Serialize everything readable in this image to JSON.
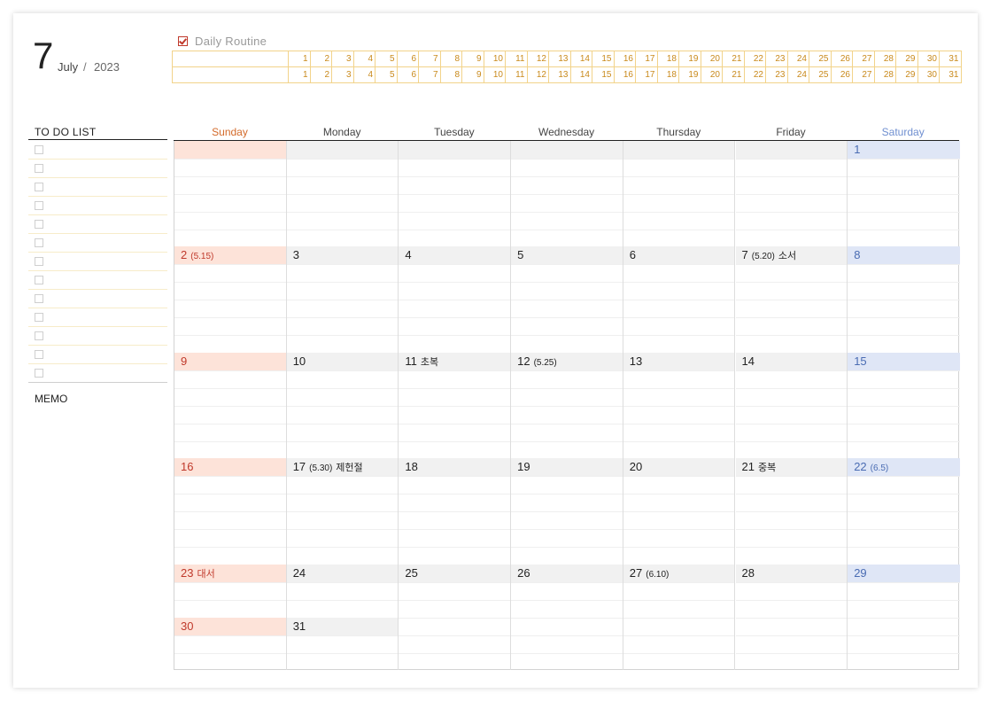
{
  "header": {
    "month_number": "7",
    "month_name": "July",
    "separator": "/",
    "year": "2023"
  },
  "routine": {
    "title": "Daily Routine",
    "checkbox_color": "#c0392b",
    "days": [
      "1",
      "2",
      "3",
      "4",
      "5",
      "6",
      "7",
      "8",
      "9",
      "10",
      "11",
      "12",
      "13",
      "14",
      "15",
      "16",
      "17",
      "18",
      "19",
      "20",
      "21",
      "22",
      "23",
      "24",
      "25",
      "26",
      "27",
      "28",
      "29",
      "30",
      "31"
    ],
    "rows": 2
  },
  "todo": {
    "title": "TO DO LIST",
    "item_count": 13
  },
  "memo": {
    "title": "MEMO"
  },
  "calendar": {
    "weekdays": [
      "Sunday",
      "Monday",
      "Tuesday",
      "Wednesday",
      "Thursday",
      "Friday",
      "Saturday"
    ],
    "weekday_colors": {
      "sunday": "#d36a2a",
      "saturday": "#6f8fd0",
      "default": "#444444"
    },
    "weeks": [
      [
        {
          "d": ""
        },
        {
          "d": ""
        },
        {
          "d": ""
        },
        {
          "d": ""
        },
        {
          "d": ""
        },
        {
          "d": ""
        },
        {
          "d": "1"
        }
      ],
      [
        {
          "d": "2",
          "small": "(5.15)"
        },
        {
          "d": "3"
        },
        {
          "d": "4"
        },
        {
          "d": "5"
        },
        {
          "d": "6"
        },
        {
          "d": "7",
          "small": "(5.20)",
          "kr": "소서"
        },
        {
          "d": "8"
        }
      ],
      [
        {
          "d": "9"
        },
        {
          "d": "10"
        },
        {
          "d": "11",
          "kr": "초복"
        },
        {
          "d": "12",
          "small": "(5.25)"
        },
        {
          "d": "13"
        },
        {
          "d": "14"
        },
        {
          "d": "15"
        }
      ],
      [
        {
          "d": "16"
        },
        {
          "d": "17",
          "small": "(5.30)",
          "kr": "제헌절"
        },
        {
          "d": "18"
        },
        {
          "d": "19"
        },
        {
          "d": "20"
        },
        {
          "d": "21",
          "kr": "중복"
        },
        {
          "d": "22",
          "small": "(6.5)"
        }
      ],
      [
        {
          "d": "23",
          "kr": "대서"
        },
        {
          "d": "24"
        },
        {
          "d": "25"
        },
        {
          "d": "26"
        },
        {
          "d": "27",
          "small": "(6.10)"
        },
        {
          "d": "28"
        },
        {
          "d": "29"
        }
      ]
    ],
    "overflow": [
      {
        "d": "30"
      },
      {
        "d": "31"
      }
    ]
  }
}
